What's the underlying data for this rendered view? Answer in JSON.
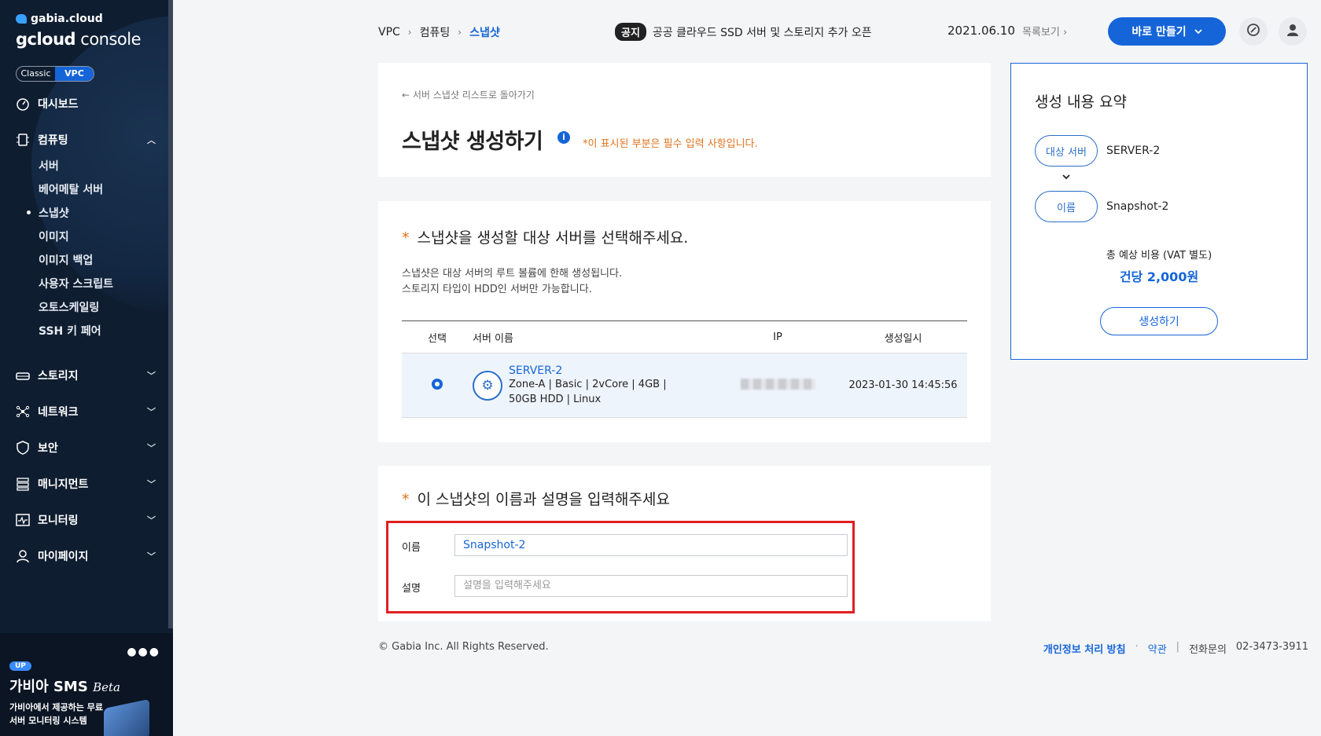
{
  "sidebar": {
    "logo_top": "gabia.cloud",
    "logo_main_a": "gcloud",
    "logo_main_b": " console",
    "switch_classic": "Classic",
    "switch_vpc": "VPC",
    "dashboard": "대시보드",
    "computing": "컴퓨팅",
    "sub_items": [
      "서버",
      "베어메탈 서버",
      "스냅샷",
      "이미지",
      "이미지 백업",
      "사용자 스크립트",
      "오토스케일링",
      "SSH 키 페어"
    ],
    "storage": "스토리지",
    "network": "네트워크",
    "security": "보안",
    "management": "매니지먼트",
    "monitoring": "모니터링",
    "mypage": "마이페이지",
    "promo": {
      "badge": "UP",
      "title": "가비아 SMS",
      "title_beta": "Beta",
      "desc": "가비아에서 제공하는 무료 서버 모니터링 시스템"
    }
  },
  "header": {
    "breadcrumb": [
      "VPC",
      "컴퓨팅",
      "스냅샷"
    ],
    "notice_badge": "공지",
    "notice_text": "공공 클라우드 SSD 서버 및 스토리지 추가 오픈",
    "notice_date": "2021.06.10",
    "notice_more": "목록보기",
    "make_button": "바로 만들기"
  },
  "title_card": {
    "back_link": "서버 스냅샷 리스트로 돌아가기",
    "title": "스냅샷 생성하기",
    "required_note": "*이 표시된 부분은 필수 입력 사항입니다."
  },
  "server_card": {
    "title": "스냅샷을 생성할 대상 서버를 선택해주세요.",
    "help_line1": "스냅샷은 대상 서버의 루트 볼륨에 한해 생성됩니다.",
    "help_line2": "스토리지 타입이 HDD인 서버만 가능합니다.",
    "columns": [
      "선택",
      "서버 이름",
      "IP",
      "생성일시"
    ],
    "row": {
      "name": "SERVER-2",
      "spec_line1": "Zone-A  |  Basic  |  2vCore  |  4GB  |",
      "spec_line2": "50GB HDD  |  Linux",
      "created": "2023-01-30 14:45:56"
    }
  },
  "name_card": {
    "title": "이 스냅샷의 이름과 설명을 입력해주세요",
    "name_label": "이름",
    "name_value": "Snapshot-2",
    "desc_label": "설명",
    "desc_placeholder": "설명을 입력해주세요"
  },
  "summary": {
    "title": "생성 내용 요약",
    "target_label": "대상 서버",
    "target_value": "SERVER-2",
    "name_label": "이름",
    "name_value": "Snapshot-2",
    "cost_label": "총 예상 비용 (VAT 별도)",
    "cost_value": "건당 2,000원",
    "create_button": "생성하기"
  },
  "footer": {
    "copyright": "© Gabia Inc. All Rights Reserved.",
    "privacy": "개인정보 처리 방침",
    "terms": "약관",
    "phone_label": "전화문의",
    "phone": "02-3473-3911"
  },
  "colors": {
    "accent": "#1565d8",
    "sidebar": "#0f1d30",
    "required": "#e0731c",
    "highlight": "#e02020"
  }
}
